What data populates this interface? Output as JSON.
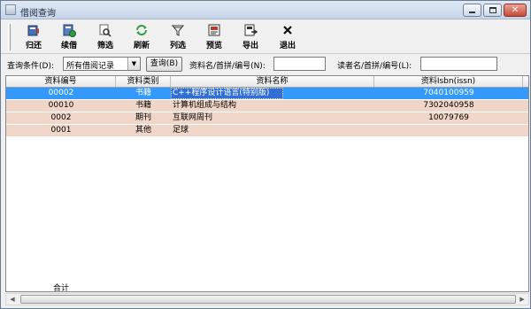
{
  "window": {
    "title": "借阅查询",
    "icon": "window-icon"
  },
  "toolbar": {
    "items": [
      {
        "label": "归还",
        "icon": "return-icon"
      },
      {
        "label": "续借",
        "icon": "renew-icon"
      },
      {
        "label": "筛选",
        "icon": "filter-icon"
      },
      {
        "label": "刷新",
        "icon": "refresh-icon"
      },
      {
        "label": "列选",
        "icon": "column-select-icon"
      },
      {
        "label": "预览",
        "icon": "preview-icon"
      },
      {
        "label": "导出",
        "icon": "export-icon"
      },
      {
        "label": "退出",
        "icon": "close-icon"
      }
    ]
  },
  "query": {
    "condition_label": "查询条件(D):",
    "condition_value": "所有借阅记录",
    "query_button": "查询(B)",
    "material_label": "资料名/首拼/编号(N):",
    "material_value": "",
    "reader_label": "读者名/首拼/编号(L):",
    "reader_value": ""
  },
  "grid": {
    "columns": [
      "资料编号",
      "资料类别",
      "资料名称",
      "资料Isbn(issn)"
    ],
    "rows": [
      {
        "id": "00002",
        "type": "书籍",
        "name": "C++程序设计语言(特别版)",
        "isbn": "7040100959",
        "selected": true
      },
      {
        "id": "00010",
        "type": "书籍",
        "name": "计算机组成与结构",
        "isbn": "7302040958",
        "selected": false
      },
      {
        "id": "0002",
        "type": "期刊",
        "name": "互联网周刊",
        "isbn": "10079769",
        "selected": false
      },
      {
        "id": "0001",
        "type": "其他",
        "name": "足球",
        "isbn": "",
        "selected": false
      }
    ]
  },
  "footer": {
    "total_label": "合计"
  },
  "colors": {
    "selected_row": "#3399ff",
    "row": "#efd6c8",
    "title_bar": "#c6d5e8"
  }
}
